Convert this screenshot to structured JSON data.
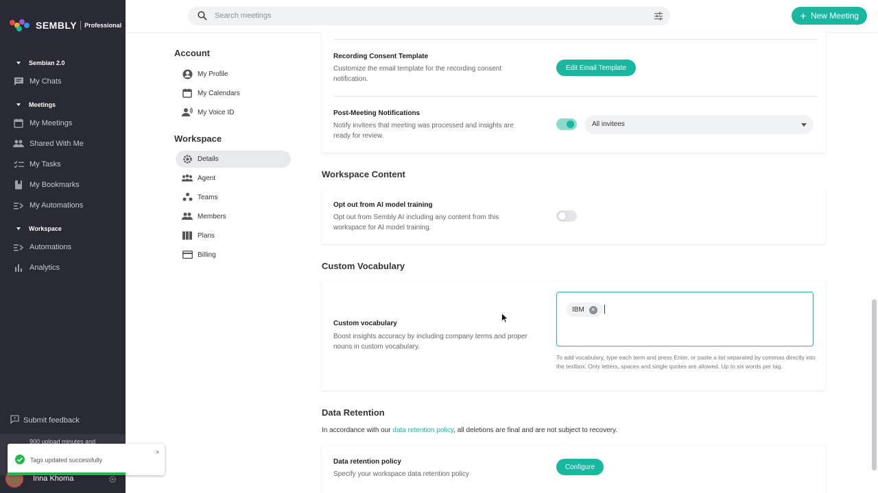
{
  "colors": {
    "sidebar_bg": "#292a33",
    "accent": "#17b7a0",
    "success": "#23b84d"
  },
  "sidebar": {
    "brand": "SEMBLY",
    "plan": "Professional",
    "sections": [
      {
        "label": "Sembian 2.0"
      },
      {
        "label": "Meetings"
      },
      {
        "label": "Workspace"
      }
    ],
    "items": [
      {
        "label": "My Chats",
        "icon": "chat-icon"
      },
      {
        "label": "My Meetings",
        "icon": "calendar-icon"
      },
      {
        "label": "Shared With Me",
        "icon": "people-icon"
      },
      {
        "label": "My Tasks",
        "icon": "checklist-icon"
      },
      {
        "label": "My Bookmarks",
        "icon": "bookmark-icon"
      },
      {
        "label": "My Automations",
        "icon": "automation-icon"
      },
      {
        "label": "Automations",
        "icon": "automation-icon"
      },
      {
        "label": "Analytics",
        "icon": "bar-chart-icon"
      }
    ],
    "feedback": "Submit feedback",
    "upload_text": "900 upload minutes and",
    "user_name": "Inna Khoma"
  },
  "toast": {
    "message": "Tags updated successfully",
    "close": "×"
  },
  "topbar": {
    "search_placeholder": "Search meetings",
    "new_meeting": "New Meeting"
  },
  "settings_nav": {
    "account_heading": "Account",
    "account_items": [
      "My Profile",
      "My Calendars",
      "My Voice ID"
    ],
    "workspace_heading": "Workspace",
    "workspace_items": [
      "Details",
      "Agent",
      "Teams",
      "Members",
      "Plans",
      "Billing"
    ]
  },
  "main": {
    "consent": {
      "title": "Recording Consent Template",
      "desc": "Customize the email template for the recording consent notification.",
      "button": "Edit Email Template"
    },
    "post_meeting": {
      "title": "Post-Meeting Notifications",
      "desc": "Notify invitees that meeting was processed and insights are ready for review.",
      "toggle_on": true,
      "select_value": "All invitees"
    },
    "workspace_content": {
      "heading": "Workspace Content",
      "title": "Opt out from AI model training",
      "desc": "Opt out from Sembly AI including any content from this workspace for AI model training.",
      "toggle_on": false
    },
    "custom_vocab": {
      "heading": "Custom Vocabulary",
      "title": "Custom vocabulary",
      "desc": "Boost insights accuracy by including company terms and proper nouns in custom vocabulary.",
      "tags": [
        "IBM"
      ],
      "help": "To add vocabulary, type each term and press Enter, or paste a list separated by commas directly into the textbox. Only letters, spaces and single quotes are allowed. Up to six words per tag."
    },
    "data_retention": {
      "heading": "Data Retention",
      "intro_prefix": "In accordance with our ",
      "intro_link": "data retention policy",
      "intro_suffix": ", all deletions are final and are not subject to recovery.",
      "title": "Data retention policy",
      "desc": "Specify your workspace data retention policy",
      "button": "Configure"
    }
  }
}
